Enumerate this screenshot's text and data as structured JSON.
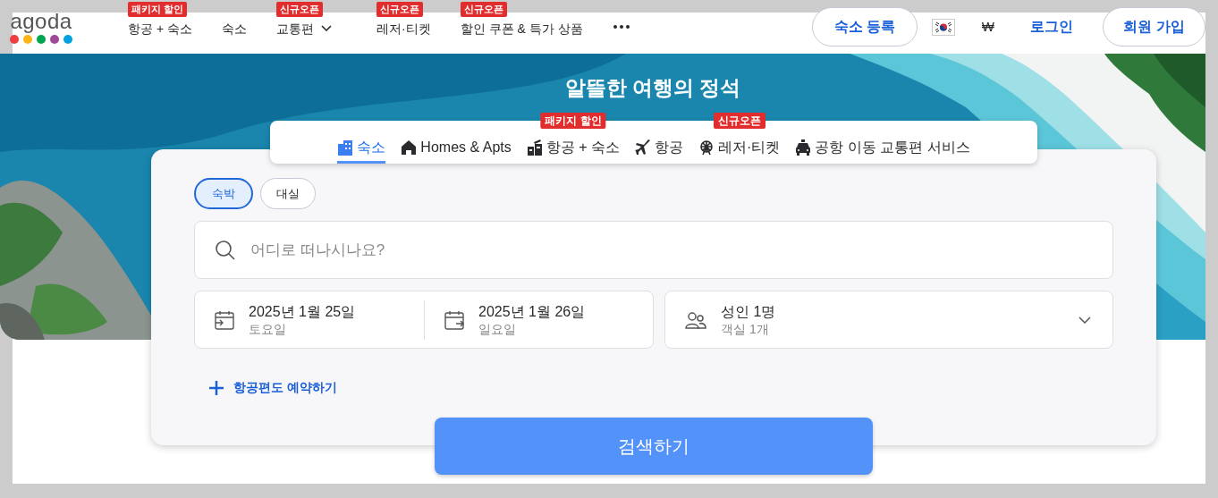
{
  "logo": {
    "text": "agoda"
  },
  "nav": [
    {
      "label": "항공 + 숙소",
      "badge": "패키지 할인",
      "dropdown": false
    },
    {
      "label": "숙소",
      "dropdown": false
    },
    {
      "label": "교통편",
      "badge": "신규오픈",
      "dropdown": true
    },
    {
      "label": "레저·티켓",
      "badge": "신규오픈",
      "dropdown": false
    },
    {
      "label": "할인 쿠폰 & 특가 상품",
      "badge": "신규오픈",
      "dropdown": false
    }
  ],
  "header_actions": {
    "list_property": "숙소 등록",
    "currency": "₩",
    "login": "로그인",
    "signup": "회원 가입"
  },
  "hero_title": "알뜰한 여행의 정석",
  "product_tabs": [
    {
      "label": "숙소",
      "selected": true
    },
    {
      "label": "Homes & Apts",
      "selected": false
    },
    {
      "label": "항공 + 숙소",
      "badge": "패키지 할인",
      "selected": false
    },
    {
      "label": "항공",
      "selected": false
    },
    {
      "label": "레저·티켓",
      "badge": "신규오픈",
      "selected": false
    },
    {
      "label": "공항 이동 교통편 서비스",
      "selected": false
    }
  ],
  "stay_types": [
    {
      "label": "숙박",
      "selected": true
    },
    {
      "label": "대실",
      "selected": false
    }
  ],
  "search": {
    "placeholder": "어디로 떠나시나요?"
  },
  "dates": [
    {
      "date": "2025년 1월 25일",
      "weekday": "토요일"
    },
    {
      "date": "2025년 1월 26일",
      "weekday": "일요일"
    }
  ],
  "occupancy": {
    "guests": "성인 1명",
    "rooms": "객실 1개"
  },
  "add_flight": "항공편도 예약하기",
  "search_button": "검색하기"
}
